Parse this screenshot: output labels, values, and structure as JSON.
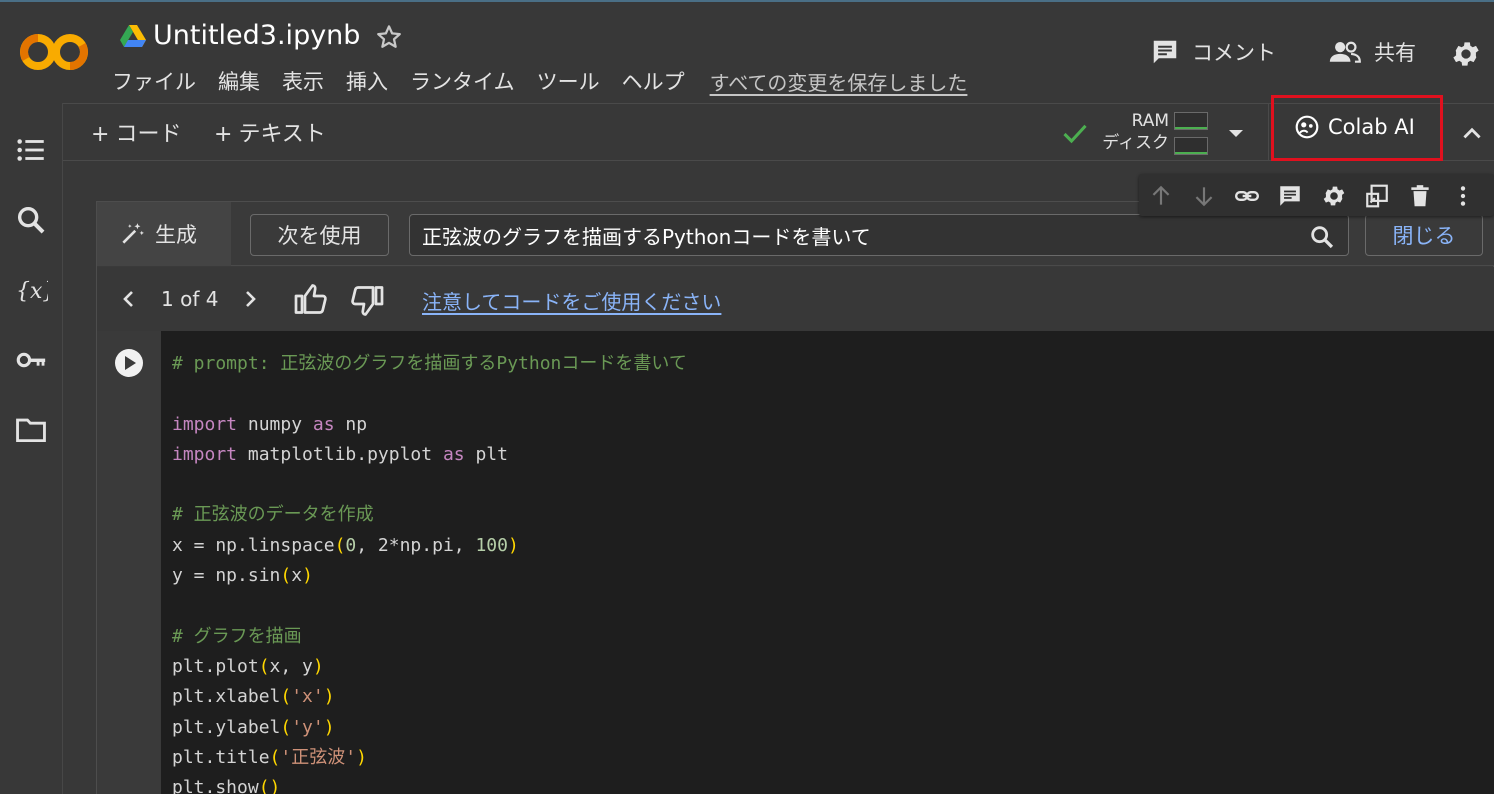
{
  "app": {
    "notebook_title": "Untitled3.ipynb",
    "save_status": "すべての変更を保存しました"
  },
  "menu": [
    "ファイル",
    "編集",
    "表示",
    "挿入",
    "ランタイム",
    "ツール",
    "ヘルプ"
  ],
  "header_right": {
    "comment_label": "コメント",
    "share_label": "共有"
  },
  "toolbar": {
    "add_code": "コード",
    "add_text": "テキスト",
    "ram_label": "RAM",
    "disk_label": "ディスク",
    "colab_ai_label": "Colab AI"
  },
  "generate": {
    "tab_label": "生成",
    "next_use_label": "次を使用",
    "prompt": "正弦波のグラフを描画するPythonコードを書いて",
    "close_label": "閉じる",
    "counter": "1 of 4",
    "caution_link": "注意してコードをご使用ください"
  },
  "code": {
    "lines": [
      [
        {
          "t": "# prompt: 正弦波のグラフを描画するPythonコードを書いて",
          "c": "c-cmt"
        }
      ],
      [],
      [
        {
          "t": "import",
          "c": "c-kw"
        },
        {
          "t": " numpy "
        },
        {
          "t": "as",
          "c": "c-kw"
        },
        {
          "t": " np"
        }
      ],
      [
        {
          "t": "import",
          "c": "c-kw"
        },
        {
          "t": " matplotlib.pyplot "
        },
        {
          "t": "as",
          "c": "c-kw"
        },
        {
          "t": " plt"
        }
      ],
      [],
      [
        {
          "t": "# 正弦波のデータを作成",
          "c": "c-cmt"
        }
      ],
      [
        {
          "t": "x = np.linspace"
        },
        {
          "t": "(",
          "c": "c-par"
        },
        {
          "t": "0",
          "c": "c-num"
        },
        {
          "t": ", 2*np.pi, "
        },
        {
          "t": "100",
          "c": "c-num"
        },
        {
          "t": ")",
          "c": "c-par"
        }
      ],
      [
        {
          "t": "y = np.sin"
        },
        {
          "t": "(",
          "c": "c-par"
        },
        {
          "t": "x"
        },
        {
          "t": ")",
          "c": "c-par"
        }
      ],
      [],
      [
        {
          "t": "# グラフを描画",
          "c": "c-cmt"
        }
      ],
      [
        {
          "t": "plt.plot"
        },
        {
          "t": "(",
          "c": "c-par"
        },
        {
          "t": "x, y"
        },
        {
          "t": ")",
          "c": "c-par"
        }
      ],
      [
        {
          "t": "plt.xlabel"
        },
        {
          "t": "(",
          "c": "c-par"
        },
        {
          "t": "'x'",
          "c": "c-str"
        },
        {
          "t": ")",
          "c": "c-par"
        }
      ],
      [
        {
          "t": "plt.ylabel"
        },
        {
          "t": "(",
          "c": "c-par"
        },
        {
          "t": "'y'",
          "c": "c-str"
        },
        {
          "t": ")",
          "c": "c-par"
        }
      ],
      [
        {
          "t": "plt.title"
        },
        {
          "t": "(",
          "c": "c-par"
        },
        {
          "t": "'正弦波'",
          "c": "c-str"
        },
        {
          "t": ")",
          "c": "c-par"
        }
      ],
      [
        {
          "t": "plt.show"
        },
        {
          "t": "()",
          "c": "c-par"
        }
      ]
    ]
  },
  "colors": {
    "accent_link": "#8ab4f8",
    "highlight_box": "#e0101e",
    "status_ok": "#4caf50"
  }
}
